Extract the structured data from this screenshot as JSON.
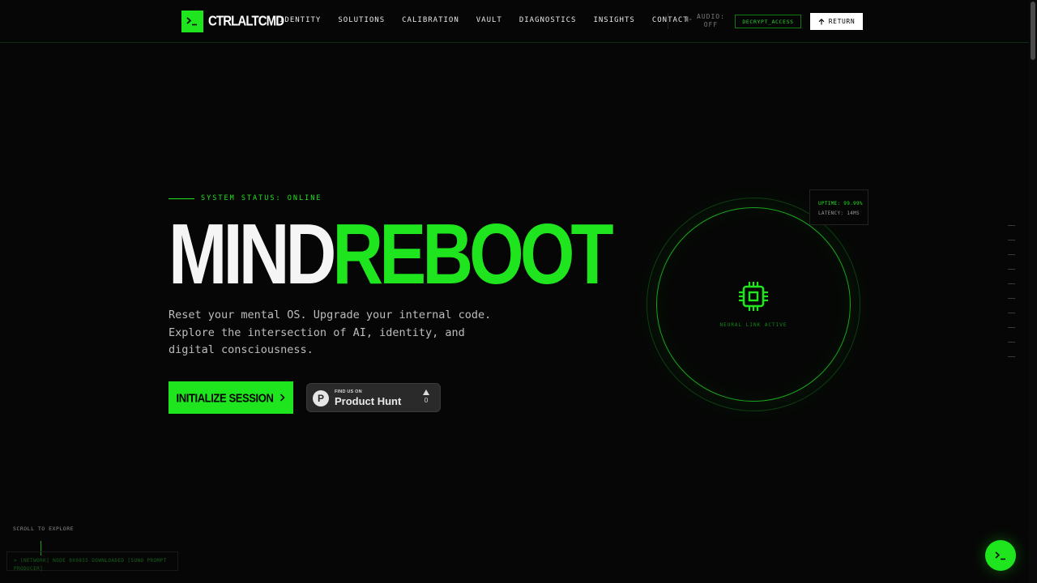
{
  "header": {
    "logo_text": "CTRLALTCMD",
    "nav": [
      "IDENTITY",
      "SOLUTIONS",
      "CALIBRATION",
      "VAULT",
      "DIAGNOSTICS",
      "INSIGHTS",
      "CONTACT"
    ],
    "audio_label": "AUDIO:",
    "audio_state": "OFF",
    "decrypt_label": "DECRYPT_ACCESS",
    "return_label": "RETURN"
  },
  "hero": {
    "status": "SYSTEM STATUS: ONLINE",
    "title_white": "MIND",
    "title_green": "REBOOT",
    "description": "Reset your mental OS. Upgrade your internal code. Explore the intersection of AI, identity, and digital consciousness.",
    "cta_label": "INITIALIZE SESSION",
    "product_hunt": {
      "small": "FIND US ON",
      "big": "Product Hunt",
      "votes": "0"
    }
  },
  "widget": {
    "neural_label": "NEURAL LINK ACTIVE",
    "uptime": "UPTIME: 99.99%",
    "latency": "LATENCY: 14MS"
  },
  "bottom": {
    "scroll_label": "SCROLL TO EXPLORE",
    "log": "> [NETWORK] NODE 0X0855 DOWNLOADED [SUNO PROMPT PRODUCER]"
  },
  "colors": {
    "accent": "#1fe51f",
    "background": "#060606"
  }
}
